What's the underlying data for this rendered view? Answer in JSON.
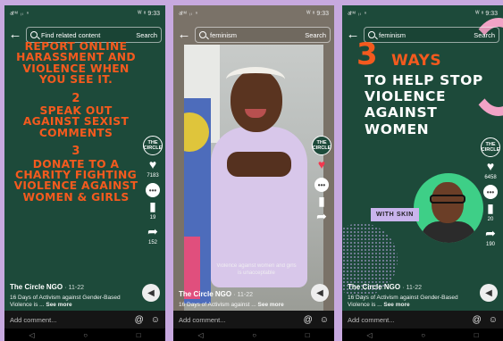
{
  "status": {
    "left": "ॳᴹ ᵢₗ ⁿ",
    "right": "ᵂ ⁸ 9:33"
  },
  "screens": [
    {
      "search_query": "Find related content",
      "search_button": "Search",
      "headline": [
        {
          "num": "",
          "text": "REPORT ONLINE HARASSMENT AND VIOLENCE WHEN YOU SEE IT."
        },
        {
          "num": "2",
          "text": "SPEAK OUT AGAINST SEXIST COMMENTS"
        },
        {
          "num": "3",
          "text": "DONATE TO A CHARITY FIGHTING VIOLENCE AGAINST WOMEN & GIRLS"
        }
      ],
      "logo_text": "THE CIRCLE",
      "likes": "7183",
      "comments": "",
      "saves": "19",
      "shares": "152",
      "author": "The Circle NGO",
      "date": "· 11-22",
      "desc": "16 Days of Activism against Gender-Based Violence is ...",
      "see_more": "See more",
      "comment_placeholder": "Add comment..."
    },
    {
      "search_query": "feminism",
      "search_button": "Search",
      "caption": "Violence against women and girls is unacceptable",
      "logo_text": "THE CIRCLE",
      "likes": "",
      "saves": "",
      "shares": "",
      "author": "The Circle NGO",
      "date": "· 11-22",
      "desc": "16 Days of Activism against ...",
      "see_more": "See more",
      "comment_placeholder": "Add comment..."
    },
    {
      "search_query": "feminism",
      "search_button": "Search",
      "big_number": "3",
      "ways": "WAYS",
      "headline": "TO HELP STOP VIOLENCE AGAINST WOMEN",
      "tag": "WITH SKIN",
      "logo_text": "THE CIRCLE",
      "likes": "6458",
      "comments": "",
      "saves": "20",
      "shares": "190",
      "author": "The Circle NGO",
      "date": "· 11-22",
      "desc": "16 Days of Activism against Gender-Based Violence is ...",
      "see_more": "See more",
      "comment_placeholder": "Add comment..."
    }
  ]
}
